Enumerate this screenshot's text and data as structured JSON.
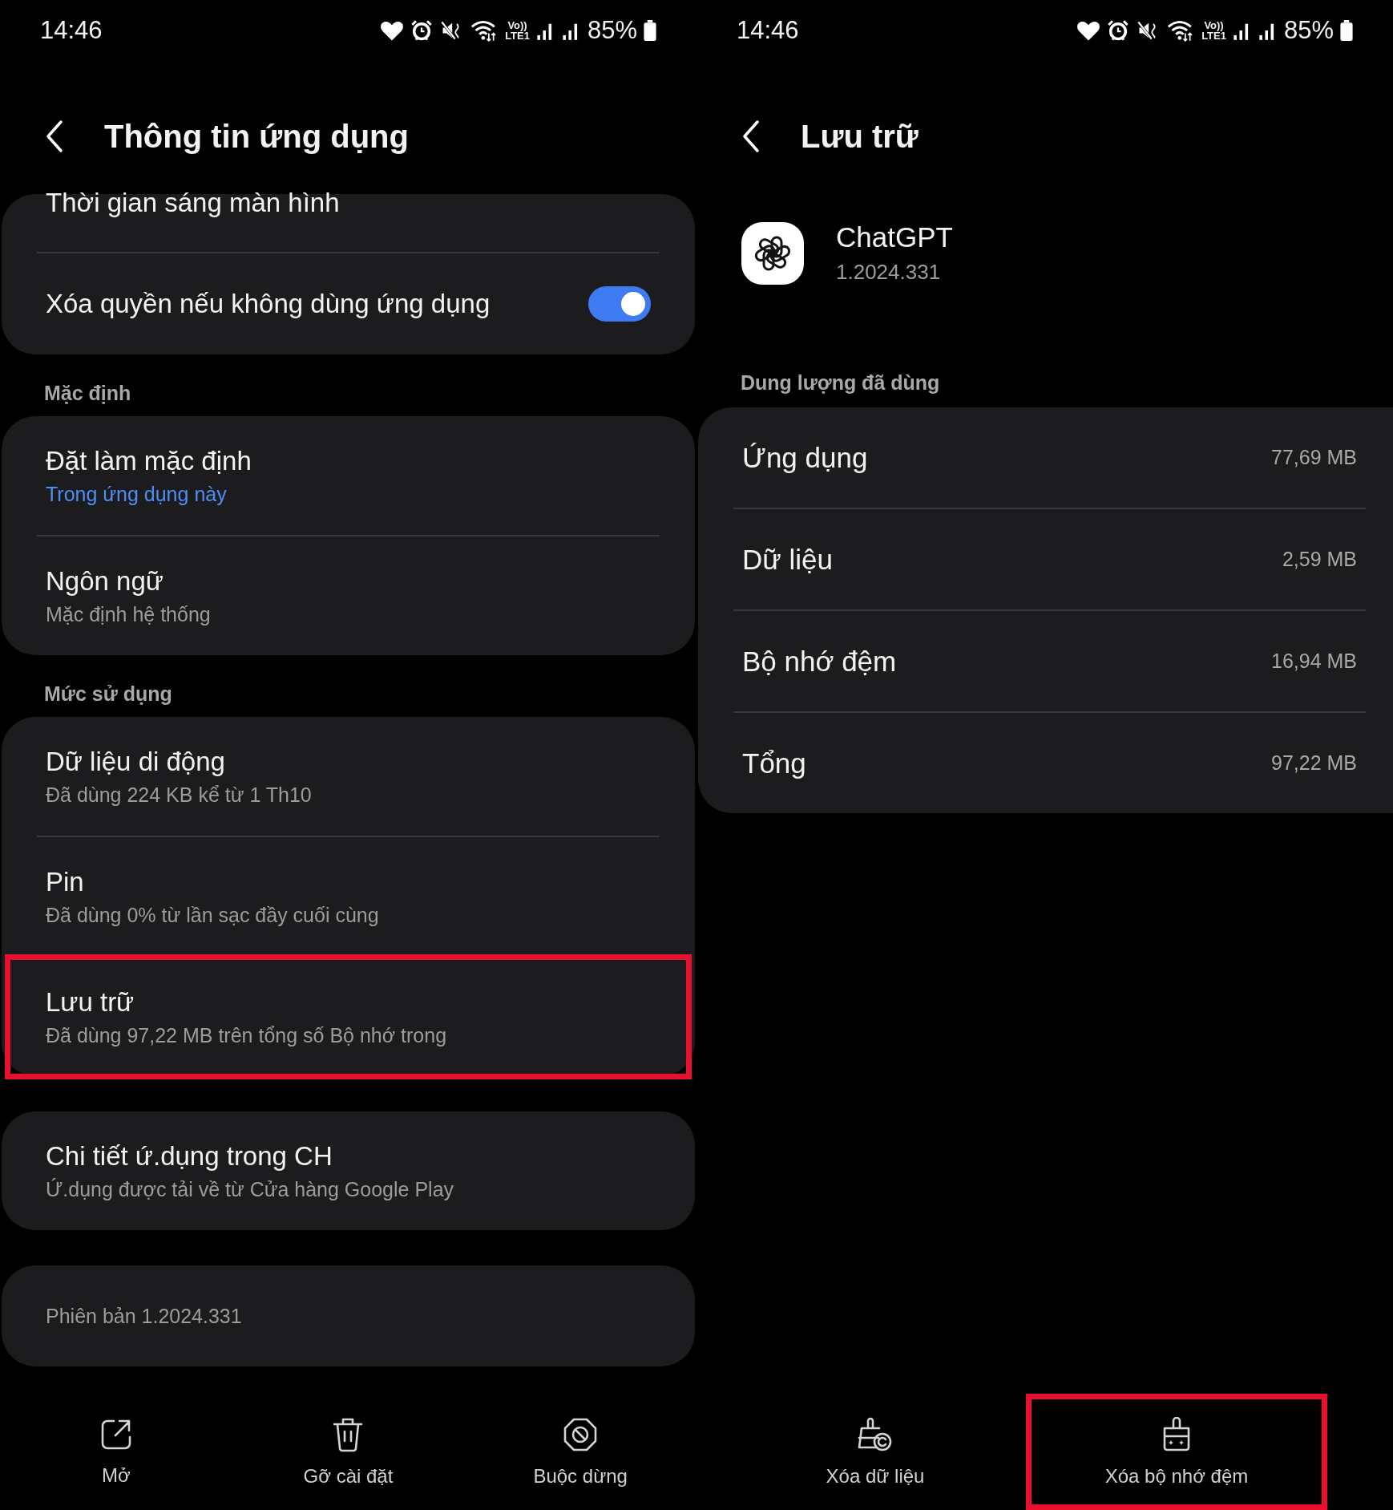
{
  "left_screen": {
    "status_bar": {
      "time": "14:46",
      "network_top": "Vo))",
      "network_bottom": "LTE1",
      "battery": "85%"
    },
    "header": {
      "title": "Thông tin ứng dụng"
    },
    "sections": [
      {
        "items": [
          {
            "kind": "cut",
            "title": "Thời gian sáng màn hình",
            "highlighted": false
          },
          {
            "kind": "toggle",
            "title": "Xóa quyền nếu không dùng ứng dụng",
            "on": true,
            "highlighted": false
          }
        ]
      },
      {
        "heading": "Mặc định",
        "items": [
          {
            "kind": "link",
            "title": "Đặt làm mặc định",
            "subtitle": "Trong ứng dụng này",
            "highlighted": false
          },
          {
            "kind": "nav",
            "title": "Ngôn ngữ",
            "subtitle": "Mặc định hệ thống",
            "highlighted": false
          }
        ]
      },
      {
        "heading": "Mức sử dụng",
        "items": [
          {
            "kind": "nav",
            "title": "Dữ liệu di động",
            "subtitle": "Đã dùng 224 KB kể từ 1 Th10",
            "highlighted": false
          },
          {
            "kind": "nav",
            "title": "Pin",
            "subtitle": "Đã dùng 0% từ lần sạc đầy cuối cùng",
            "highlighted": false
          },
          {
            "kind": "nav",
            "title": "Lưu trữ",
            "subtitle": "Đã dùng 97,22 MB trên tổng số Bộ nhớ trong",
            "highlighted": true
          }
        ]
      },
      {
        "items": [
          {
            "kind": "nav",
            "title": "Chi tiết ứ.dụng trong CH",
            "subtitle": "Ứ.dụng được tải về từ Cửa hàng Google Play",
            "highlighted": false
          }
        ]
      },
      {
        "items": [
          {
            "kind": "info",
            "title": "Phiên bản 1.2024.331",
            "highlighted": false
          }
        ]
      }
    ],
    "actions": [
      {
        "kind": "open",
        "label": "Mở",
        "highlighted": false
      },
      {
        "kind": "trash",
        "label": "Gỡ cài đặt",
        "highlighted": false
      },
      {
        "kind": "stop",
        "label": "Buộc dừng",
        "highlighted": false
      }
    ]
  },
  "right_screen": {
    "status_bar": {
      "time": "14:46",
      "network_top": "Vo))",
      "network_bottom": "LTE1",
      "battery": "85%"
    },
    "header": {
      "title": "Lưu trữ"
    },
    "app": {
      "name": "ChatGPT",
      "version": "1.2024.331"
    },
    "heading": "Dung lượng đã dùng",
    "rows": [
      {
        "label": "Ứng dụng",
        "value": "77,69 MB"
      },
      {
        "label": "Dữ liệu",
        "value": "2,59 MB"
      },
      {
        "label": "Bộ nhớ đệm",
        "value": "16,94 MB"
      },
      {
        "label": "Tổng",
        "value": "97,22 MB"
      }
    ],
    "actions": [
      {
        "kind": "clear-data",
        "label": "Xóa dữ liệu",
        "highlighted": false
      },
      {
        "kind": "clear-cache",
        "label": "Xóa bộ nhớ đệm",
        "highlighted": true
      }
    ]
  }
}
